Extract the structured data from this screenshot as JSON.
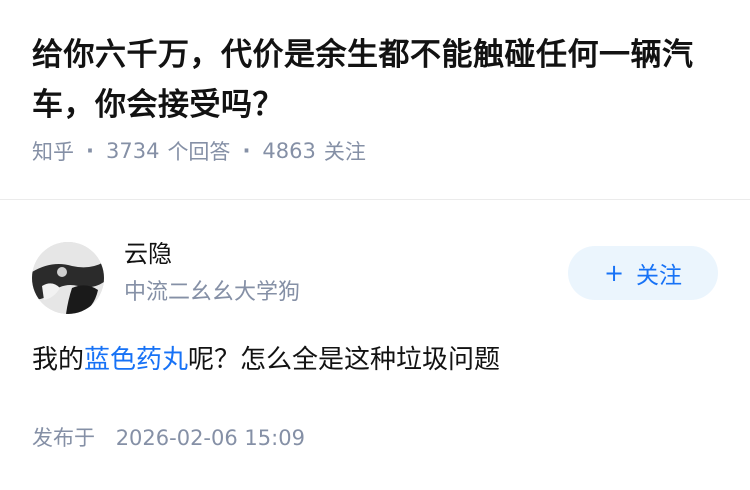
{
  "question": {
    "title": "给你六千万，代价是余生都不能触碰任何一辆汽车，你会接受吗？",
    "source": "知乎",
    "answers_count": "3734",
    "answers_label": "个回答",
    "followers_count": "4863",
    "followers_label": "关注",
    "separator": "·"
  },
  "author": {
    "name": "云隐",
    "bio": "中流二幺幺大学狗",
    "avatar_icon": "avatar-icon",
    "follow_label": "关注",
    "follow_plus": "+"
  },
  "answer": {
    "text_before": "我的",
    "link_text": "蓝色药丸",
    "text_after": "呢？怎么全是这种垃圾问题"
  },
  "publish": {
    "label": "发布于",
    "time": "2026-02-06 15:09"
  },
  "colors": {
    "link": "#1772f6",
    "meta": "#8590a6",
    "follow_bg": "#ebf5fd"
  }
}
